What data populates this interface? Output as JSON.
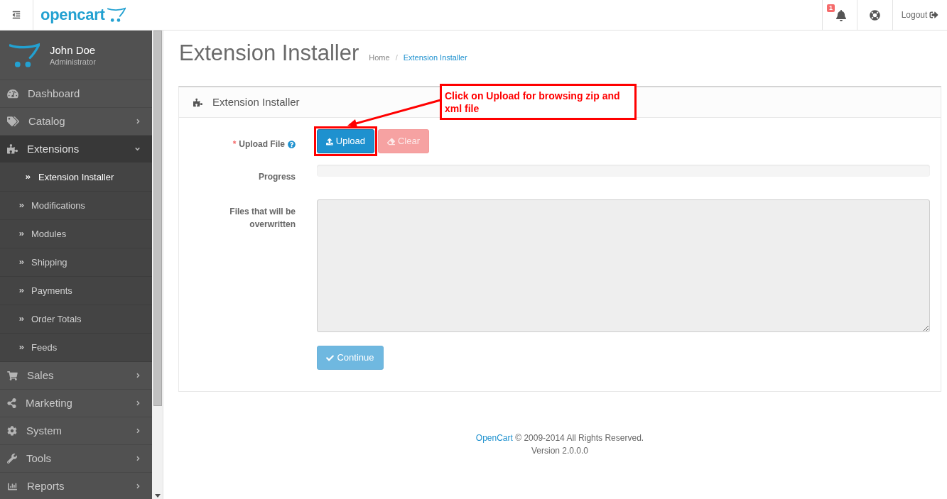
{
  "header": {
    "logo": "opencart",
    "notification_count": "1",
    "logout": "Logout"
  },
  "sidebar": {
    "user": {
      "name": "John Doe",
      "role": "Administrator"
    },
    "items": [
      {
        "label": "Dashboard",
        "kind": "link",
        "expanded": false
      },
      {
        "label": "Catalog",
        "kind": "group",
        "expanded": false
      },
      {
        "label": "Extensions",
        "kind": "group",
        "expanded": true,
        "children": [
          {
            "label": "Extension Installer",
            "selected": true
          },
          {
            "label": "Modifications",
            "selected": false
          },
          {
            "label": "Modules",
            "selected": false
          },
          {
            "label": "Shipping",
            "selected": false
          },
          {
            "label": "Payments",
            "selected": false
          },
          {
            "label": "Order Totals",
            "selected": false
          },
          {
            "label": "Feeds",
            "selected": false
          }
        ]
      },
      {
        "label": "Sales",
        "kind": "group",
        "expanded": false
      },
      {
        "label": "Marketing",
        "kind": "group",
        "expanded": false
      },
      {
        "label": "System",
        "kind": "group",
        "expanded": false
      },
      {
        "label": "Tools",
        "kind": "group",
        "expanded": false
      },
      {
        "label": "Reports",
        "kind": "group",
        "expanded": false
      }
    ]
  },
  "page": {
    "title": "Extension Installer",
    "breadcrumb": [
      {
        "label": "Home",
        "active": false
      },
      {
        "label": "Extension Installer",
        "active": true
      }
    ],
    "breadcrumb_separator": "/"
  },
  "panel": {
    "title": "Extension Installer",
    "fields": [
      {
        "kind": "upload",
        "required_mark": "*",
        "label": "Upload File",
        "buttons": [
          {
            "label": "Upload",
            "disabled": false
          },
          {
            "label": "Clear",
            "disabled": true
          }
        ]
      },
      {
        "kind": "progress",
        "label": "Progress"
      },
      {
        "kind": "textarea",
        "label": "Files that will be overwritten",
        "disabled": true
      }
    ],
    "submit": {
      "label": "Continue",
      "disabled": true
    }
  },
  "annotation": {
    "text": "Click on Upload for browsing zip and xml file"
  },
  "footer": {
    "link": "OpenCart",
    "text": "© 2009-2014 All Rights Reserved.",
    "version": "Version 2.0.0.0"
  }
}
